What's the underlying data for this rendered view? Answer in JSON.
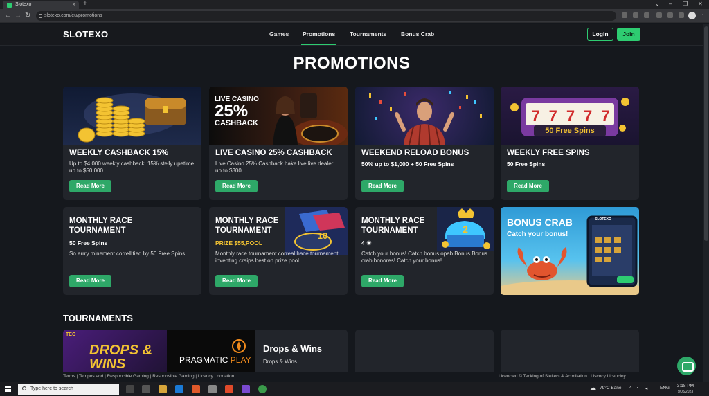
{
  "browser": {
    "tab_title": "Slotexo",
    "url": "slotexo.com/eu/promotions"
  },
  "nav": {
    "logo": "SLOTEXO",
    "links": [
      "Games",
      "Promotions",
      "Tournaments",
      "Bonus Crab"
    ],
    "active": "Promotions",
    "login": "Login",
    "join": "Join"
  },
  "page_title": "PROMOTIONS",
  "promos": [
    {
      "title": "WEEKLY CASHBACK 15%",
      "subtitle": "",
      "desc": "Up to $4,000  weekly cashback. 15% stelly upetime up to $50,000.",
      "button": "Read More",
      "image_text": ""
    },
    {
      "title": "LIVE CASINO 25% CASHBACK",
      "subtitle": "",
      "desc": "Live Casino 25% Cashback hake live live dealer: up to $300.",
      "button": "Read More",
      "image_text": {
        "line1": "LIVE CASINO",
        "line2": "25%",
        "line3": "CASHBACK"
      }
    },
    {
      "title": "WEEKEND RELOAD BONUS",
      "subtitle": "50% up to $1,000 + 50 Free Spins",
      "desc": "",
      "button": "Read More",
      "image_text": ""
    },
    {
      "title": "WEEKLY FREE SPINS",
      "subtitle": "50 Free Spins",
      "desc": "",
      "button": "Read More",
      "image_text": {
        "reels": [
          "7",
          "7",
          "7",
          "7",
          "7"
        ],
        "banner": "50 Free Spins"
      }
    },
    {
      "title": "MONTHLY RACE TOURNAMENT",
      "subtitle": "50 Free Spins",
      "desc": "So errry minement correllitied by 50 Free Spins.",
      "button": "Read More",
      "image_text": ""
    },
    {
      "title": "MONTHLY RACE TOURNAMENT",
      "subtitle": "PRIZE $55,POOL",
      "desc": "Monthly race tournament correal hace tournament inventing craips best on prize pool.",
      "button": "Read More",
      "image_text": {
        "badge": "10"
      }
    },
    {
      "title": "MONTHLY RACE TOURNAMENT",
      "subtitle": "4 ☀",
      "desc": "Catch your bonus! Catch bonus opab Bonus Bonus crab bonores! Catch your bonus!",
      "button": "Read More",
      "image_text": {
        "badge": "2"
      }
    },
    {
      "title": "BONUS CRAB",
      "subtitle": "Catch your bonus!",
      "desc": "",
      "button": "",
      "image_text": {
        "tablet_logo": "SLOTEXO"
      }
    }
  ],
  "tournaments": {
    "section_title": "TOURNAMENTS",
    "featured": {
      "banner_line1": "DROPS &",
      "banner_line2": "WINS",
      "ribbon": "TEO",
      "provider_word1": "PRAGMATIC",
      "provider_word2": "PLAY",
      "title": "Drops & Wins",
      "subtitle": "Drops & Wins"
    }
  },
  "footer": {
    "links": "Terms | Tempos and | Responcible Gaming | Responsible Gaming | Licency Ldonation",
    "right": "Licencied © Tecking of Stellers & Actmilation | Liscocy Licencioy"
  },
  "taskbar": {
    "search_placeholder": "Type here to search",
    "weather": "79°C  Bane",
    "lang": "ENG",
    "time": "3:18 PM",
    "date": "9/05/2023"
  }
}
